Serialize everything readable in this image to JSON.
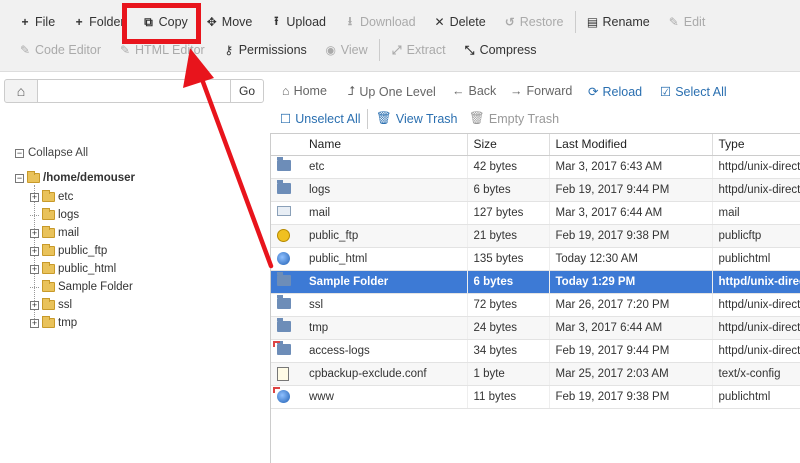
{
  "toolbar": {
    "row1": [
      {
        "label": "File",
        "icon": "plus-icon",
        "glyph": "+",
        "disabled": false
      },
      {
        "label": "Folder",
        "icon": "plus-icon",
        "glyph": "+",
        "disabled": false
      },
      {
        "label": "Copy",
        "icon": "copy-icon",
        "glyph": "⧉",
        "disabled": false
      },
      {
        "label": "Move",
        "icon": "move-icon",
        "glyph": "✥",
        "disabled": false
      },
      {
        "label": "Upload",
        "icon": "upload-icon",
        "glyph": "⭱",
        "disabled": false
      },
      {
        "label": "Download",
        "icon": "download-icon",
        "glyph": "⭳",
        "disabled": true
      },
      {
        "label": "Delete",
        "icon": "close-icon",
        "glyph": "✕",
        "disabled": false
      },
      {
        "label": "Restore",
        "icon": "undo-icon",
        "glyph": "↺",
        "disabled": true
      },
      {
        "label": "Rename",
        "icon": "file-icon",
        "glyph": "▤",
        "disabled": false
      },
      {
        "label": "Edit",
        "icon": "pencil-icon",
        "glyph": "✎",
        "disabled": true
      }
    ],
    "row2": [
      {
        "label": "Code Editor",
        "icon": "pencil-icon",
        "glyph": "✎",
        "disabled": true
      },
      {
        "label": "HTML Editor",
        "icon": "pencil-icon",
        "glyph": "✎",
        "disabled": true
      },
      {
        "label": "Permissions",
        "icon": "key-icon",
        "glyph": "⚷",
        "disabled": false
      },
      {
        "label": "View",
        "icon": "eye-icon",
        "glyph": "◉",
        "disabled": true
      },
      {
        "label": "Extract",
        "icon": "expand-icon",
        "glyph": "⤢",
        "disabled": true
      },
      {
        "label": "Compress",
        "icon": "compress-icon",
        "glyph": "⤡",
        "disabled": false
      }
    ]
  },
  "path_bar": {
    "path_value": "",
    "go_label": "Go"
  },
  "nav": {
    "home": "Home",
    "up_one_level": "Up One Level",
    "back": "Back",
    "forward": "Forward",
    "reload": "Reload",
    "select_all": "Select All",
    "unselect_all": "Unselect All",
    "view_trash": "View Trash",
    "empty_trash": "Empty Trash"
  },
  "tree": {
    "collapse_all": "Collapse All",
    "root": "/home/demouser",
    "children": [
      {
        "label": "etc",
        "expandable": true
      },
      {
        "label": "logs",
        "expandable": false
      },
      {
        "label": "mail",
        "expandable": true
      },
      {
        "label": "public_ftp",
        "expandable": true
      },
      {
        "label": "public_html",
        "expandable": true
      },
      {
        "label": "Sample Folder",
        "expandable": false
      },
      {
        "label": "ssl",
        "expandable": true
      },
      {
        "label": "tmp",
        "expandable": true
      }
    ]
  },
  "table": {
    "headers": {
      "name": "Name",
      "size": "Size",
      "modified": "Last Modified",
      "type": "Type"
    },
    "rows": [
      {
        "icon": "folder-icon",
        "name": "etc",
        "size": "42 bytes",
        "modified": "Mar 3, 2017 6:43 AM",
        "type": "httpd/unix-directory",
        "selected": false,
        "link": false
      },
      {
        "icon": "folder-icon",
        "name": "logs",
        "size": "6 bytes",
        "modified": "Feb 19, 2017 9:44 PM",
        "type": "httpd/unix-directory",
        "selected": false,
        "link": false
      },
      {
        "icon": "mail-icon",
        "name": "mail",
        "size": "127 bytes",
        "modified": "Mar 3, 2017 6:44 AM",
        "type": "mail",
        "selected": false,
        "link": false
      },
      {
        "icon": "ftp-icon",
        "name": "public_ftp",
        "size": "21 bytes",
        "modified": "Feb 19, 2017 9:38 PM",
        "type": "publicftp",
        "selected": false,
        "link": false
      },
      {
        "icon": "globe-icon",
        "name": "public_html",
        "size": "135 bytes",
        "modified": "Today 12:30 AM",
        "type": "publichtml",
        "selected": false,
        "link": false
      },
      {
        "icon": "folder-icon",
        "name": "Sample Folder",
        "size": "6 bytes",
        "modified": "Today 1:29 PM",
        "type": "httpd/unix-directory",
        "selected": true,
        "link": false
      },
      {
        "icon": "folder-icon",
        "name": "ssl",
        "size": "72 bytes",
        "modified": "Mar 26, 2017 7:20 PM",
        "type": "httpd/unix-directory",
        "selected": false,
        "link": false
      },
      {
        "icon": "folder-icon",
        "name": "tmp",
        "size": "24 bytes",
        "modified": "Mar 3, 2017 6:44 AM",
        "type": "httpd/unix-directory",
        "selected": false,
        "link": false
      },
      {
        "icon": "folder-icon",
        "name": "access-logs",
        "size": "34 bytes",
        "modified": "Feb 19, 2017 9:44 PM",
        "type": "httpd/unix-directory",
        "selected": false,
        "link": true
      },
      {
        "icon": "config-file-icon",
        "name": "cpbackup-exclude.conf",
        "size": "1 byte",
        "modified": "Mar 25, 2017 2:03 AM",
        "type": "text/x-config",
        "selected": false,
        "link": false
      },
      {
        "icon": "globe-icon",
        "name": "www",
        "size": "11 bytes",
        "modified": "Feb 19, 2017 9:38 PM",
        "type": "publichtml",
        "selected": false,
        "link": true
      }
    ]
  },
  "colors": {
    "selection": "#3d7ad5",
    "annotation": "#e8141c",
    "link_blue": "#2a6fb0"
  }
}
